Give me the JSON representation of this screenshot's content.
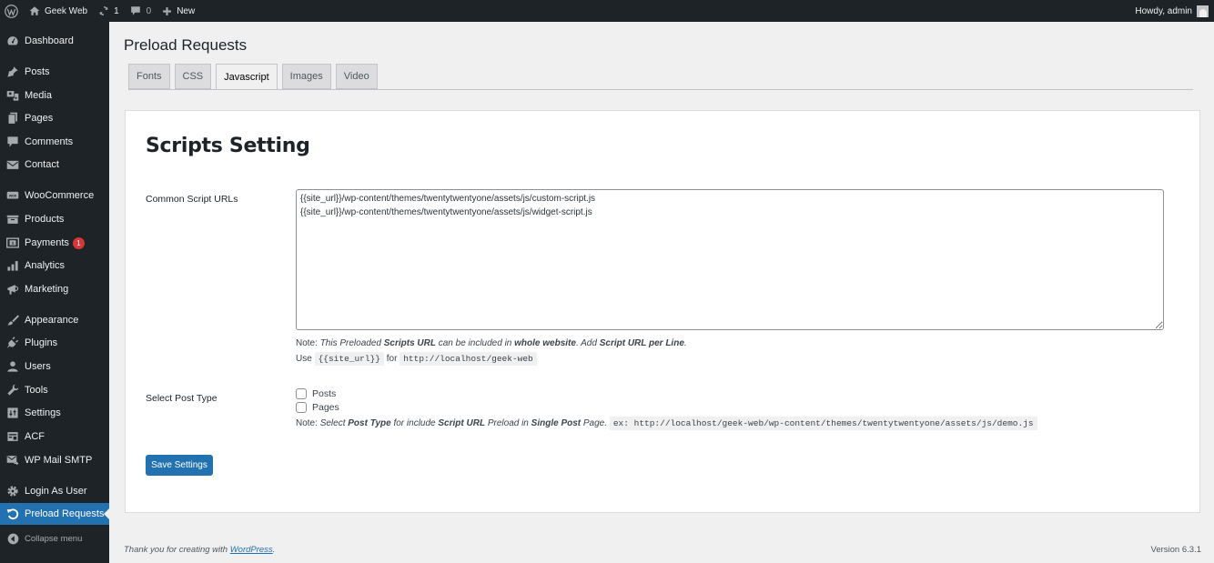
{
  "adminbar": {
    "site_name": "Geek Web",
    "updates_count": "1",
    "comments_count": "0",
    "new_label": "New",
    "howdy": "Howdy, admin"
  },
  "sidebar": {
    "items": [
      {
        "label": "Dashboard",
        "icon": "dashboard-icon"
      },
      {
        "label": "Posts",
        "icon": "pin-icon"
      },
      {
        "label": "Media",
        "icon": "media-icon"
      },
      {
        "label": "Pages",
        "icon": "pages-icon"
      },
      {
        "label": "Comments",
        "icon": "comment-icon"
      },
      {
        "label": "Contact",
        "icon": "envelope-icon"
      },
      {
        "label": "WooCommerce",
        "icon": "woo-icon"
      },
      {
        "label": "Products",
        "icon": "archive-icon"
      },
      {
        "label": "Payments",
        "icon": "money-icon",
        "badge": "1"
      },
      {
        "label": "Analytics",
        "icon": "bar-chart-icon"
      },
      {
        "label": "Marketing",
        "icon": "megaphone-icon"
      },
      {
        "label": "Appearance",
        "icon": "brush-icon"
      },
      {
        "label": "Plugins",
        "icon": "plug-icon"
      },
      {
        "label": "Users",
        "icon": "user-icon"
      },
      {
        "label": "Tools",
        "icon": "wrench-icon"
      },
      {
        "label": "Settings",
        "icon": "sliders-icon"
      },
      {
        "label": "ACF",
        "icon": "table-icon"
      },
      {
        "label": "WP Mail SMTP",
        "icon": "mail-forward-icon"
      },
      {
        "label": "Login As User",
        "icon": "gear-icon"
      },
      {
        "label": "Preload Requests",
        "icon": "refresh-icon",
        "current": true
      }
    ],
    "collapse_label": "Collapse menu"
  },
  "page": {
    "title": "Preload Requests",
    "tabs": [
      "Fonts",
      "CSS",
      "Javascript",
      "Images",
      "Video"
    ],
    "active_tab": "Javascript"
  },
  "form": {
    "heading": "Scripts Setting",
    "script_urls_label": "Common Script URLs",
    "script_urls_value": "{{site_url}}/wp-content/themes/twentytwentyone/assets/js/custom-script.js\n{{site_url}}/wp-content/themes/twentytwentyone/assets/js/widget-script.js",
    "note1": {
      "prefix": "Note:",
      "t1": "This Preloaded",
      "b1": "Scripts URL",
      "t2": "can be included in",
      "b2": "whole website",
      "t3": ". Add",
      "b3": "Script URL per Line",
      "t4": "."
    },
    "use_line": {
      "use": "Use",
      "code1": "{{site_url}}",
      "for": "for",
      "code2": "http://localhost/geek-web"
    },
    "post_type_label": "Select Post Type",
    "post_types": [
      {
        "label": "Posts",
        "checked": false
      },
      {
        "label": "Pages",
        "checked": false
      }
    ],
    "note2": {
      "prefix": "Note:",
      "t1": "Select",
      "b1": "Post Type",
      "t2": "for include",
      "b2": "Script URL",
      "t3": "Preload in",
      "b3": "Single Post",
      "t4": "Page.",
      "example": "ex: http://localhost/geek-web/wp-content/themes/twentytwentyone/assets/js/demo.js"
    },
    "save_label": "Save Settings"
  },
  "footer": {
    "thanks_prefix": "Thank you for creating with",
    "thanks_link": "WordPress",
    "thanks_suffix": ".",
    "version": "Version 6.3.1"
  },
  "colors": {
    "admin_dark": "#1d2327",
    "accent": "#2271b1",
    "badge": "#d63638",
    "background": "#f0f0f1"
  }
}
